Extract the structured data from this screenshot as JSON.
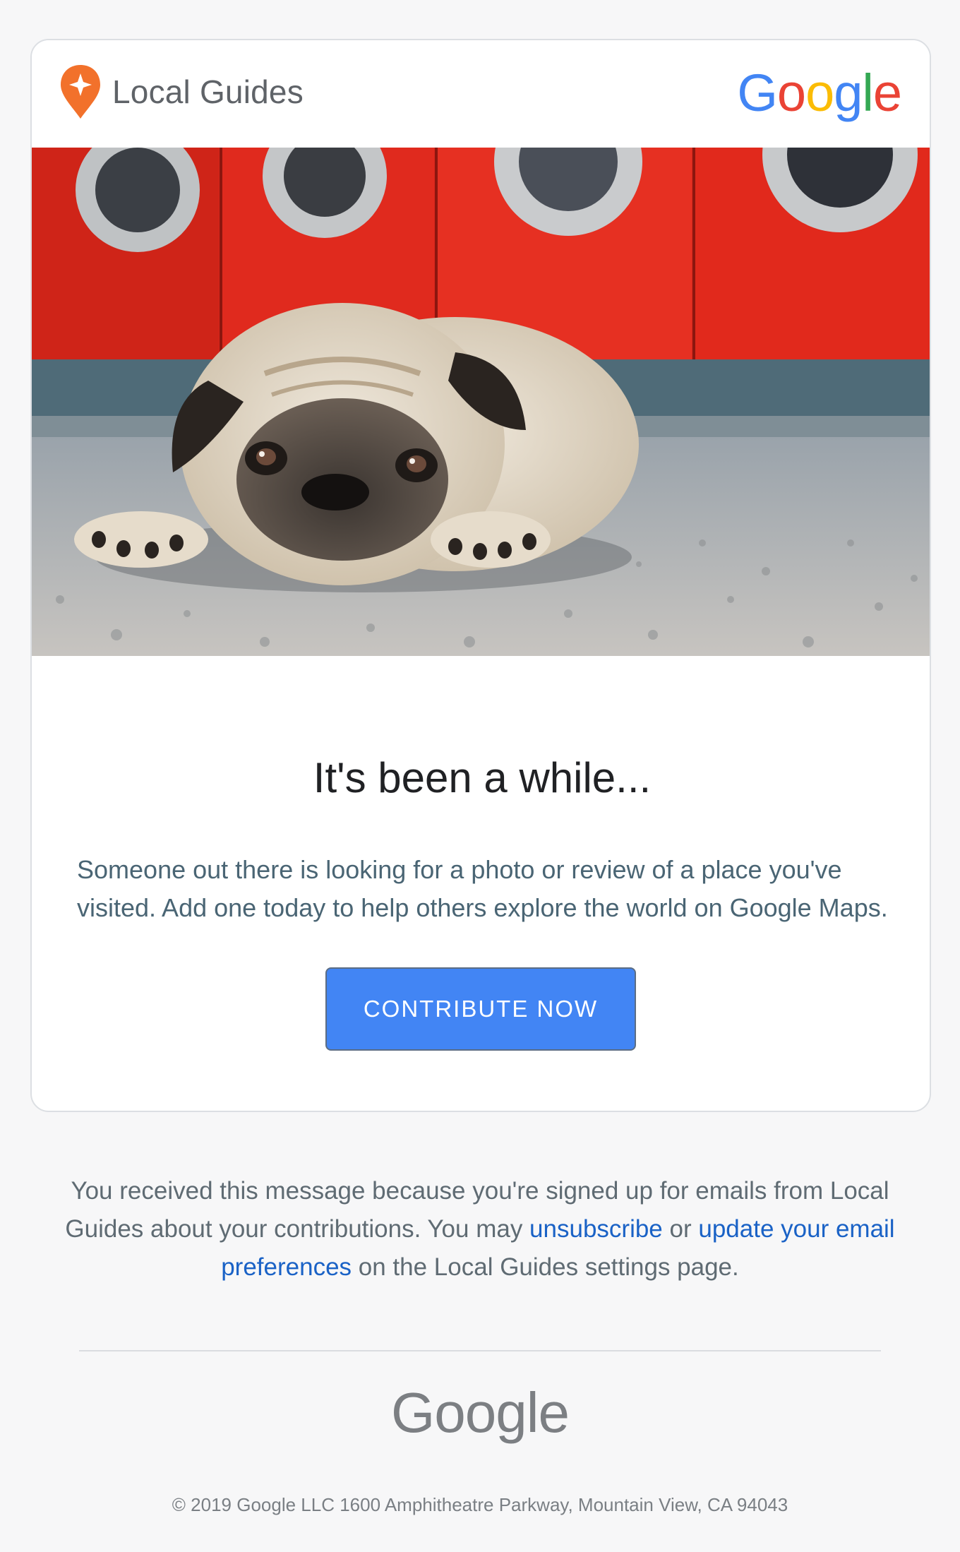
{
  "header": {
    "brand_name": "Local Guides",
    "google_logo_letters": [
      {
        "ch": "G",
        "color": "#4285F4"
      },
      {
        "ch": "o",
        "color": "#EA4335"
      },
      {
        "ch": "o",
        "color": "#FBBC05"
      },
      {
        "ch": "g",
        "color": "#4285F4"
      },
      {
        "ch": "l",
        "color": "#34A853"
      },
      {
        "ch": "e",
        "color": "#EA4335"
      }
    ],
    "pin_color": "#F2712B"
  },
  "hero": {
    "icon": "pug-photo"
  },
  "main": {
    "headline": "It's been a while...",
    "body": "Someone out there is looking for a photo or review of a place you've visited. Add one today to help others explore the world on Google Maps.",
    "cta_label": "CONTRIBUTE NOW",
    "cta_color": "#4285F4"
  },
  "footer": {
    "notice_part1": "You received this message because you're signed up for emails from Local Guides about your contributions. You may ",
    "unsubscribe_link": "unsubscribe",
    "notice_part2": " or ",
    "preferences_link": "update your email preferences",
    "notice_part3": " on the Local Guides settings page.",
    "link_color": "#1A62C6",
    "google_wordmark": "Google",
    "copyright": "© 2019 Google LLC 1600 Amphitheatre Parkway, Mountain View, CA 94043"
  }
}
